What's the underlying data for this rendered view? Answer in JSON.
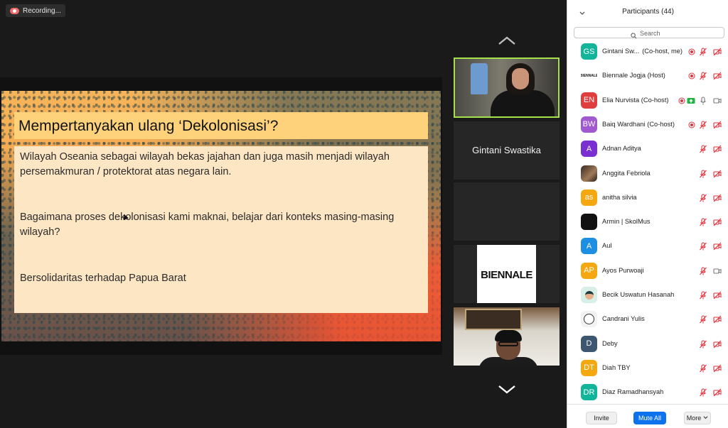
{
  "recording": {
    "label": "Recording..."
  },
  "slide": {
    "title": "Mempertanyakan ulang ‘Dekolonisasi’?",
    "paragraphs": [
      "Wilayah Oseania sebagai wilayah bekas jajahan dan juga masih menjadi wilayah persemakmuran / protektorat atas negara lain.",
      "Bagaimana proses dekolonisasi kami maknai, belajar dari konteks masing-masing wilayah?",
      "Bersolidaritas terhadap Papua Barat"
    ]
  },
  "thumbnails": {
    "active_name": "Gintani Swastika",
    "logo_text": "BIENNALE"
  },
  "panel": {
    "title": "Participants (44)",
    "search_placeholder": "Search",
    "participants": [
      {
        "initials": "GS",
        "color": "#13b59a",
        "name": "Gintani Sw...",
        "role": "(Co-host, me)",
        "recording": true,
        "share": false,
        "mic": "muted",
        "cam": "off"
      },
      {
        "initials": "",
        "color": "#ffffff",
        "avatar": "biennale-logo",
        "name": "Biennale Jogja (Host)",
        "role": "",
        "recording": true,
        "share": false,
        "mic": "muted",
        "cam": "off"
      },
      {
        "initials": "EN",
        "color": "#e03e3e",
        "name": "Elia Nurvista (Co-host)",
        "role": "",
        "recording": true,
        "share": true,
        "mic": "on",
        "cam": "on"
      },
      {
        "initials": "BW",
        "color": "#a159cf",
        "name": "Baiq Wardhani (Co-host)",
        "role": "",
        "recording": true,
        "share": false,
        "mic": "muted",
        "cam": "off"
      },
      {
        "initials": "A",
        "color": "#7a2fd0",
        "name": "Adnan Aditya",
        "role": "",
        "recording": false,
        "share": false,
        "mic": "muted",
        "cam": "off"
      },
      {
        "initials": "",
        "color": "#6b5442",
        "avatar": "photo",
        "name": "Anggita Febriola",
        "role": "",
        "recording": false,
        "share": false,
        "mic": "muted",
        "cam": "off"
      },
      {
        "initials": "as",
        "color": "#f5a70f",
        "name": "anitha silvia",
        "role": "",
        "recording": false,
        "share": false,
        "mic": "muted",
        "cam": "off"
      },
      {
        "initials": "",
        "color": "#111111",
        "avatar": "dark",
        "name": "Armin | SkolMus",
        "role": "",
        "recording": false,
        "share": false,
        "mic": "muted",
        "cam": "off"
      },
      {
        "initials": "A",
        "color": "#1c8fe3",
        "name": "Aul",
        "role": "",
        "recording": false,
        "share": false,
        "mic": "muted",
        "cam": "off"
      },
      {
        "initials": "AP",
        "color": "#f5a70f",
        "name": "Ayos Purwoaji",
        "role": "",
        "recording": false,
        "share": false,
        "mic": "muted",
        "cam": "on"
      },
      {
        "initials": "",
        "color": "#d7efe6",
        "avatar": "illustration",
        "name": "Becik Uswatun Hasanah",
        "role": "",
        "recording": false,
        "share": false,
        "mic": "muted",
        "cam": "off"
      },
      {
        "initials": "",
        "color": "#f2f2f2",
        "avatar": "cartoon",
        "name": "Candrani Yulis",
        "role": "",
        "recording": false,
        "share": false,
        "mic": "muted",
        "cam": "off"
      },
      {
        "initials": "D",
        "color": "#3e5770",
        "name": "Deby",
        "role": "",
        "recording": false,
        "share": false,
        "mic": "muted",
        "cam": "off"
      },
      {
        "initials": "DT",
        "color": "#f5a70f",
        "name": "Diah TBY",
        "role": "",
        "recording": false,
        "share": false,
        "mic": "muted",
        "cam": "off"
      },
      {
        "initials": "DR",
        "color": "#13b59a",
        "name": "Diaz Ramadhansyah",
        "role": "",
        "recording": false,
        "share": false,
        "mic": "muted",
        "cam": "off"
      }
    ],
    "footer": {
      "invite": "Invite",
      "mute_all": "Mute All",
      "more": "More"
    }
  },
  "colors": {
    "accent_blue": "#0e72ed",
    "active_speaker": "#a6e14b",
    "muted_red": "#e0323c",
    "recording_red": "#e0323c"
  }
}
